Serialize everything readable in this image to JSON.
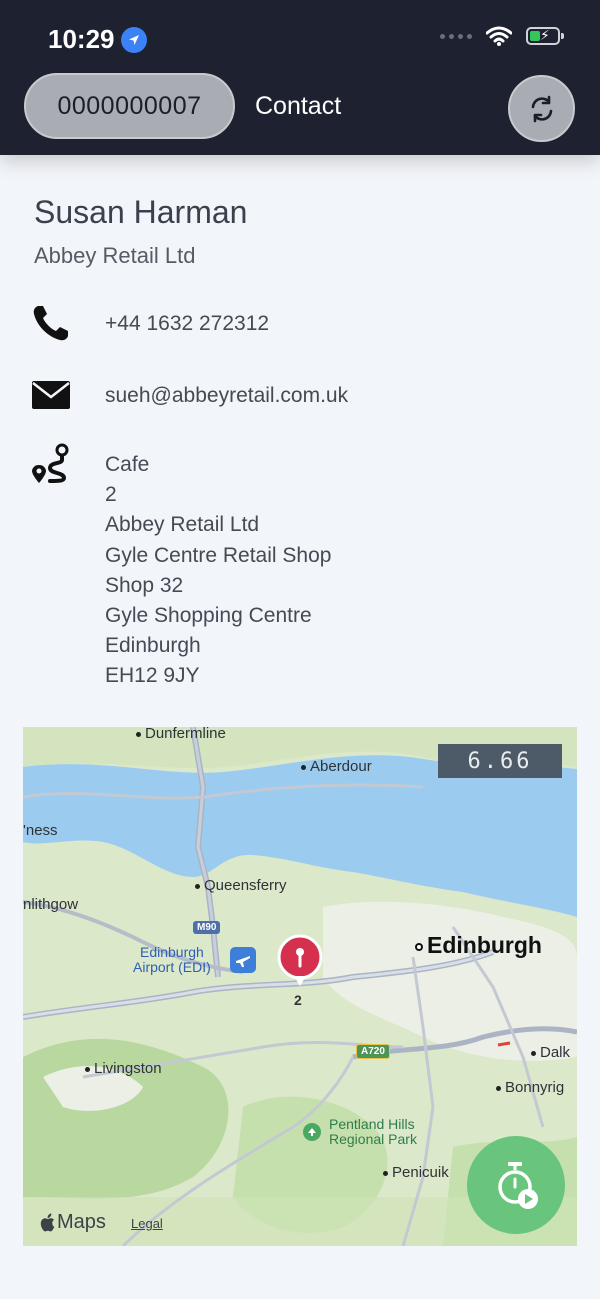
{
  "status_bar": {
    "time": "10:29"
  },
  "header": {
    "record_id": "0000000007",
    "title": "Contact"
  },
  "contact": {
    "name": "Susan Harman",
    "company": "Abbey Retail Ltd",
    "phone": "+44 1632 272312",
    "email": "sueh@abbeyretail.com.uk",
    "address_lines": [
      "Cafe",
      "2",
      "Abbey Retail Ltd",
      "Gyle Centre Retail Shop",
      "Shop 32",
      "Gyle Shopping Centre",
      "Edinburgh",
      "EH12 9JY"
    ]
  },
  "map": {
    "scale_readout": "6.66",
    "pin_label": "2",
    "labels": {
      "dunfermline": "Dunfermline",
      "aberdour": "Aberdour",
      "ness": "'ness",
      "queensferry": "Queensferry",
      "linlithgow": "nlithgow",
      "edinburgh": "Edinburgh",
      "airport_line1": "Edinburgh",
      "airport_line2": "Airport (EDI)",
      "livingston": "Livingston",
      "pentland_line1": "Pentland Hills",
      "pentland_line2": "Regional Park",
      "penicuik": "Penicuik",
      "dalkeith": "Dalk",
      "bonnyrigg": "Bonnyrig"
    },
    "road_signs": {
      "m90": "M90",
      "a720": "A720"
    },
    "brand": "Maps",
    "legal": "Legal"
  },
  "colors": {
    "header_bg": "#1e2230",
    "accent_green": "#69c47d",
    "pin_red": "#d6304f",
    "water": "#9ccbf0"
  },
  "icons": {
    "phone": "phone-icon",
    "email": "envelope-icon",
    "address": "route-pin-icon",
    "refresh": "refresh-icon",
    "timer": "stopwatch-play-icon",
    "location": "location-arrow-icon",
    "wifi": "wifi-icon",
    "battery": "battery-charging-icon"
  }
}
